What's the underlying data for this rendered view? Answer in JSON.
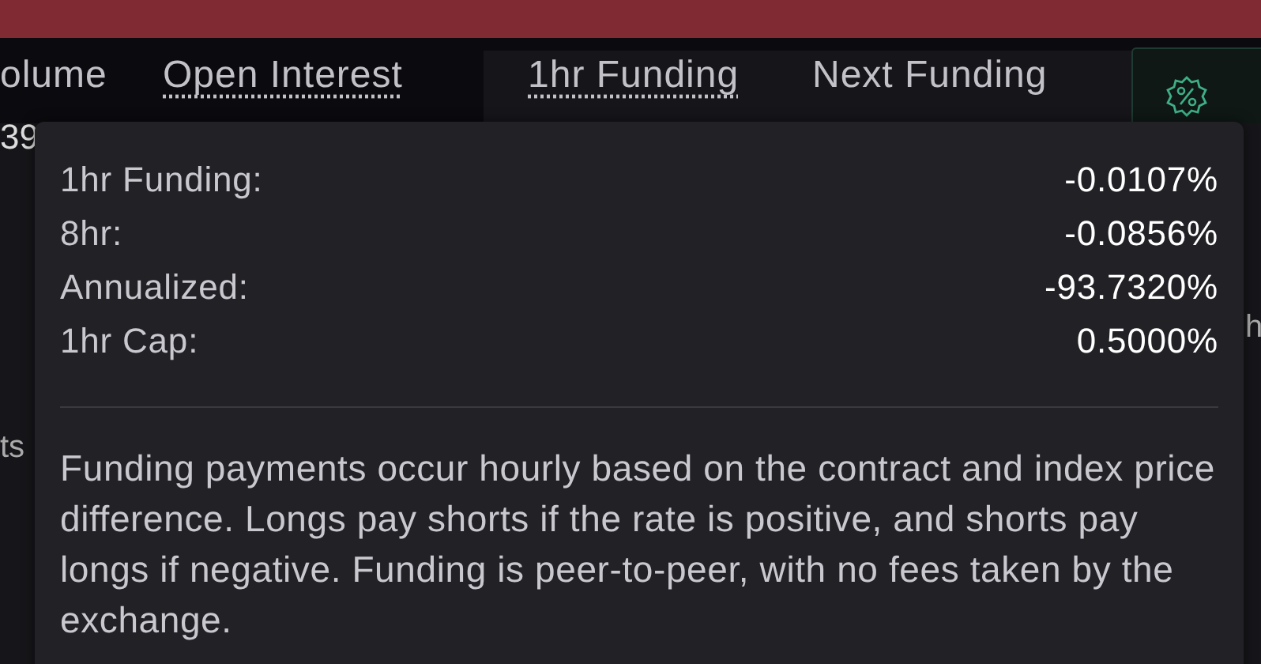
{
  "header": {
    "columns": [
      {
        "label": "olume",
        "underlined": false
      },
      {
        "label": "Open Interest",
        "underlined": true
      },
      {
        "label": "1hr Funding",
        "underlined": true
      },
      {
        "label": "Next Funding",
        "underlined": false
      }
    ]
  },
  "row": {
    "cell_1": "39"
  },
  "side_texts": {
    "left": "ts",
    "right": "h"
  },
  "tooltip": {
    "rows": [
      {
        "label": "1hr Funding:",
        "value": "-0.0107%"
      },
      {
        "label": "8hr:",
        "value": "-0.0856%"
      },
      {
        "label": "Annualized:",
        "value": "-93.7320%"
      },
      {
        "label": "1hr Cap:",
        "value": "0.5000%"
      }
    ],
    "description": "Funding payments occur hourly based on the contract and index price difference. Longs pay shorts if the rate is positive, and shorts pay longs if negative. Funding is peer-to-peer, with no fees taken by the exchange."
  }
}
